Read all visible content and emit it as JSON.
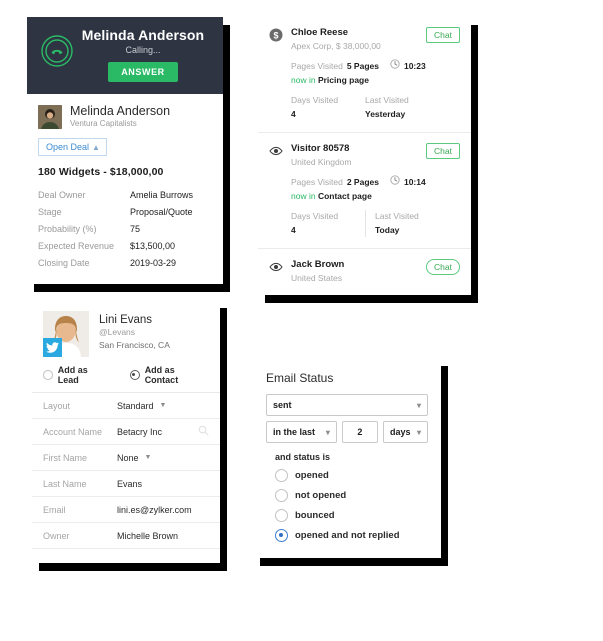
{
  "call_card": {
    "header": {
      "caller_name": "Melinda Anderson",
      "status": "Calling...",
      "answer_label": "ANSWER",
      "call_icon": "incoming-call-icon"
    },
    "contact": {
      "name": "Melinda Anderson",
      "company": "Ventura Capitalists",
      "avatar": "contact-avatar"
    },
    "open_deal_label": "Open Deal",
    "open_deal_chevron": "chevron-up-icon",
    "deal_title": "180 Widgets - $18,000,00",
    "fields": [
      {
        "label": "Deal Owner",
        "value": "Amelia Burrows"
      },
      {
        "label": "Stage",
        "value": "Proposal/Quote"
      },
      {
        "label": "Probability (%)",
        "value": "75"
      },
      {
        "label": "Expected Revenue",
        "value": "$13,500,00"
      },
      {
        "label": "Closing Date",
        "value": "2019-03-29"
      }
    ]
  },
  "visitors_card": {
    "chat_label": "Chat",
    "pages_visited_label": "Pages Visited",
    "now_in_label": "now in",
    "days_visited_label": "Days Visited",
    "last_visited_label": "Last Visited",
    "clock_icon": "clock-icon",
    "items": [
      {
        "icon": "deal-dollar-icon",
        "name": "Chloe Reese",
        "meta": "Apex Corp, $ 38,000,00",
        "pages": "5 Pages",
        "time": "10:23",
        "now_page": "Pricing page",
        "days_visited": "4",
        "last_visited": "Yesterday",
        "chat_label": "Chat",
        "show_stats": true,
        "divided": false
      },
      {
        "icon": "eye-icon",
        "name": "Visitor 80578",
        "meta": "United Kingdom",
        "pages": "2 Pages",
        "time": "10:14",
        "now_page": "Contact page",
        "days_visited": "4",
        "last_visited": "Today",
        "chat_label": "Chat",
        "show_stats": true,
        "divided": true
      },
      {
        "icon": "eye-icon",
        "name": "Jack Brown",
        "meta": "United States",
        "chat_label": "Chat",
        "show_stats": false,
        "divided": false
      }
    ]
  },
  "social_card": {
    "profile": {
      "name": "Lini Evans",
      "handle": "@Levans",
      "location": "San Francisco, CA",
      "network_icon": "twitter-icon",
      "avatar": "profile-avatar"
    },
    "add_as_lead_label": "Add as Lead",
    "add_as_contact_label": "Add as Contact",
    "selected_add_as": "contact",
    "search_icon": "search-icon",
    "fields": [
      {
        "label": "Layout",
        "value": "Standard",
        "control": "dropdown"
      },
      {
        "label": "Account Name",
        "value": "Betacry Inc",
        "control": "lookup"
      },
      {
        "label": "First Name",
        "value": "None",
        "control": "dropdown"
      },
      {
        "label": "Last Name",
        "value": "Evans",
        "control": "text"
      },
      {
        "label": "Email",
        "value": "lini.es@zylker.com",
        "control": "text"
      },
      {
        "label": "Owner",
        "value": "Michelle Brown",
        "control": "text"
      }
    ]
  },
  "email_status_card": {
    "title": "Email Status",
    "status_select": {
      "value": "sent",
      "chevron": "chevron-down-icon"
    },
    "range_select": {
      "value": "in the last",
      "chevron": "chevron-down-icon"
    },
    "range_number": "2",
    "unit_select": {
      "value": "days",
      "chevron": "chevron-down-icon"
    },
    "and_status_is_label": "and status is",
    "options": [
      {
        "label": "opened",
        "selected": false
      },
      {
        "label": "not opened",
        "selected": false
      },
      {
        "label": "bounced",
        "selected": false
      },
      {
        "label": "opened and not replied",
        "selected": true
      }
    ]
  },
  "colors": {
    "dark_header": "#2e3442",
    "green_accent": "#2aba66",
    "chat_green": "#34a853",
    "link_blue": "#3a8bcf",
    "radio_blue": "#2f6fc4",
    "twitter_blue": "#29a9e0",
    "muted_text": "#a5a5a5"
  }
}
